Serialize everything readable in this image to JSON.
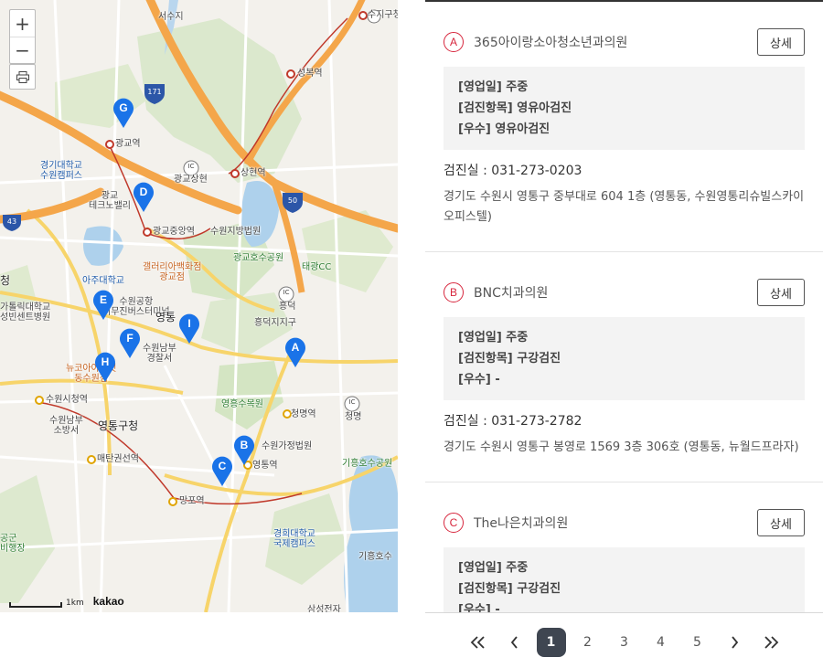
{
  "map": {
    "zoom_in": "+",
    "zoom_out": "−",
    "scale_label": "1km",
    "provider": "kakao",
    "labels": {
      "seoulsu": "서수지",
      "sujigu": "수지구청",
      "seongbok": "성복역",
      "gwanggyo_station": "광교역",
      "kgu": "경기대학교\n수원캠퍼스",
      "gwanggyo_sangwon": "광교상현",
      "sanghyeon": "상현역",
      "techno": "광교\n테크노밸리",
      "gwanggyo_jungang": "광교중앙역",
      "court": "수원지방법원",
      "galleria": "갤러리아백화점\n광교점",
      "lake_park": "광교호수공원",
      "taegwang": "태광CC",
      "ajou": "아주대학교",
      "yeongtong_ic": "흥덕",
      "heungdeok": "흥덕지지구",
      "terminal": "수원공항\n리무진버스터미널",
      "yeongtong_label": "영통",
      "police": "수원남부\n경찰서",
      "catholic": "가톨릭대학교\n성빈센트병원",
      "newcore": "뉴코아아울렛\n동수원점",
      "city_hall": "수원시청역",
      "fire": "수원남부\n소방서",
      "yeongtong_gu": "영통구청",
      "yeongheung": "영흥수목원",
      "cheongmyeong_st": "청명역",
      "cheongmyeong_ic": "청명",
      "family_court": "수원가정법원",
      "yeongtong_st": "영통역",
      "giheung_park": "기흥호수공원",
      "maetan": "매탄권선역",
      "mangpo": "망포역",
      "khu": "경희대학교\n국제캠퍼스",
      "giheung_lake": "기흥호수",
      "samsung": "삼성전자",
      "gonggun": "공군\n비행장",
      "cheong": "청",
      "r171": "171",
      "r50": "50",
      "r43": "43",
      "ic": "IC"
    },
    "markers": [
      {
        "letter": "A"
      },
      {
        "letter": "B"
      },
      {
        "letter": "C"
      },
      {
        "letter": "D"
      },
      {
        "letter": "E"
      },
      {
        "letter": "F"
      },
      {
        "letter": "G"
      },
      {
        "letter": "H"
      },
      {
        "letter": "I"
      }
    ],
    "marker_color": "#1a73e8"
  },
  "list": {
    "accent_color": "#d7263d",
    "items": [
      {
        "letter": "A",
        "name": "365아이랑소아청소년과의원",
        "detail_label": "상세",
        "info": [
          "[영업일] 주중",
          "[검진항목] 영유아검진",
          "[우수] 영유아검진"
        ],
        "phone": "검진실 :  031-273-0203",
        "address": "경기도 수원시 영통구 중부대로 604 1층 (영통동, 수원영통리슈빌스카이오피스텔)"
      },
      {
        "letter": "B",
        "name": "BNC치과의원",
        "detail_label": "상세",
        "info": [
          "[영업일] 주중",
          "[검진항목] 구강검진",
          "[우수] -"
        ],
        "phone": "검진실 :  031-273-2782",
        "address": "경기도 수원시 영통구 봉영로 1569 3층 306호 (영통동, 뉴월드프라자)"
      },
      {
        "letter": "C",
        "name": "The나은치과의원",
        "detail_label": "상세",
        "info": [
          "[영업일] 주중",
          "[검진항목] 구강검진",
          "[우수] -"
        ],
        "phone": "",
        "address": ""
      }
    ]
  },
  "pagination": {
    "pages": [
      "1",
      "2",
      "3",
      "4",
      "5"
    ],
    "current": "1",
    "icons": [
      "double-chevron-left-icon",
      "chevron-left-icon",
      "chevron-right-icon",
      "double-chevron-right-icon"
    ]
  }
}
